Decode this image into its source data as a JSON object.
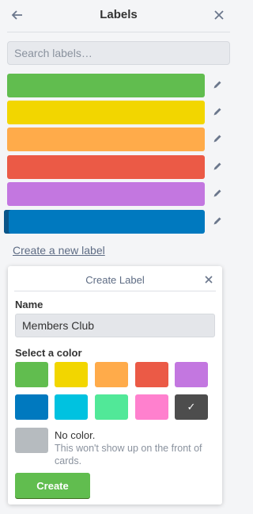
{
  "header": {
    "title": "Labels",
    "back_icon": "arrow-left-icon",
    "close_icon": "close-icon"
  },
  "search": {
    "placeholder": "Search labels…",
    "value": ""
  },
  "labels": [
    {
      "color": "#61bd4f",
      "name": ""
    },
    {
      "color": "#f2d600",
      "name": ""
    },
    {
      "color": "#ffab4a",
      "name": ""
    },
    {
      "color": "#eb5a46",
      "name": ""
    },
    {
      "color": "#c377e0",
      "name": ""
    },
    {
      "color": "#0079bf",
      "name": ""
    }
  ],
  "create_link": "Create a new label",
  "create_popover": {
    "title": "Create Label",
    "name_label": "Name",
    "name_value": "Members Club",
    "color_label": "Select a color",
    "colors": [
      "#61bd4f",
      "#f2d600",
      "#ffab4a",
      "#eb5a46",
      "#c377e0",
      "#0079bf",
      "#00c2e0",
      "#51e898",
      "#ff80ce",
      "#4d4d4d"
    ],
    "selected_color": "#4d4d4d",
    "no_color_title": "No color.",
    "no_color_desc": "This won't show up on the front of cards.",
    "create_button": "Create"
  }
}
